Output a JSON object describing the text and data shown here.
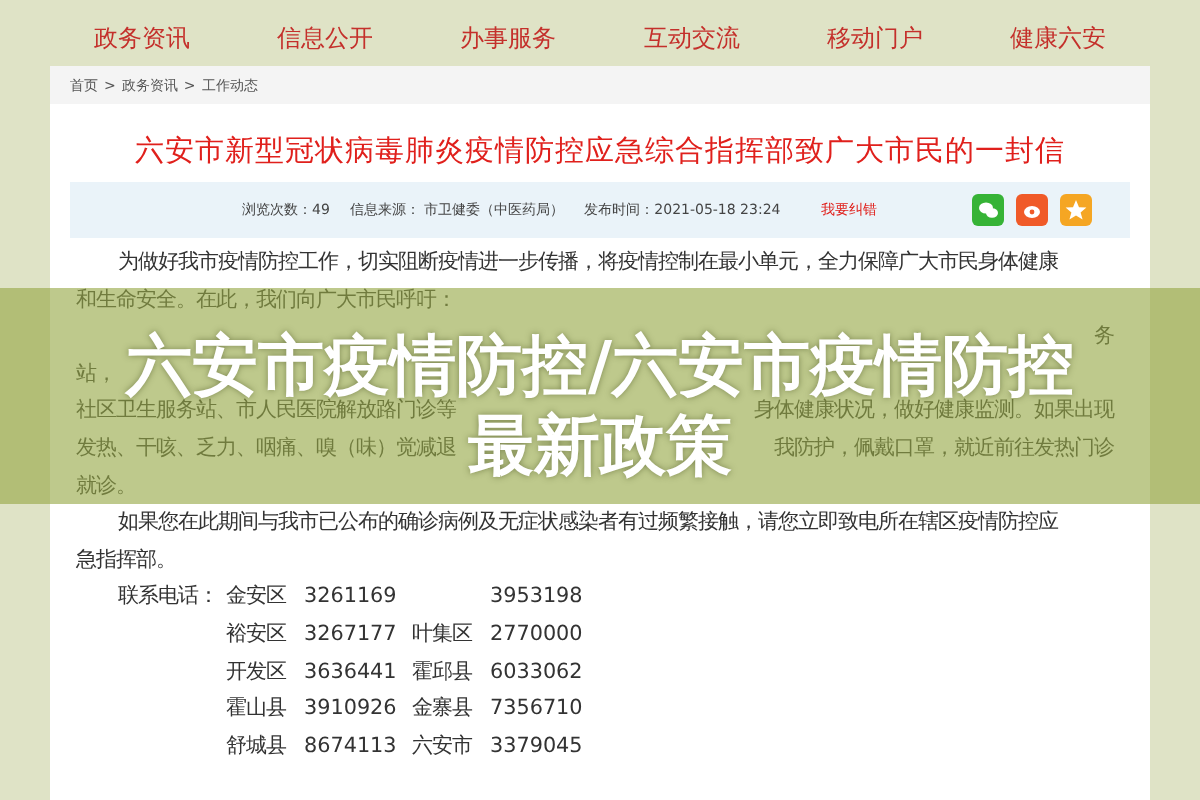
{
  "nav": [
    "政务资讯",
    "信息公开",
    "办事服务",
    "互动交流",
    "移动门户",
    "健康六安"
  ],
  "breadcrumb": {
    "items": [
      "首页",
      "政务资讯",
      "工作动态"
    ],
    "separator": ">"
  },
  "article": {
    "title": "六安市新型冠状病毒肺炎疫情防控应急综合指挥部致广大市民的一封信",
    "meta": [
      "浏览次数：49",
      "信息来源： 市卫健委（中医药局）",
      "发布时间：2021-05-18 23:24"
    ],
    "report_link": "我要纠错",
    "lines": [
      {
        "kind": "first",
        "text": "为做好我市疫情防控工作，切实阻断疫情进一步传播，将疫情控制在最小单元，全力保障广大市民身体健康"
      },
      {
        "kind": "cont",
        "text": "和生命安全。在此，我们向广大市民呼吁："
      },
      {
        "kind": "split",
        "right": "务"
      },
      {
        "kind": "split",
        "left": "站，"
      },
      {
        "kind": "split",
        "left": "社区卫生服务站、市人民医院解放路门诊等",
        "right": "身体健康状况，做好健康监测。如果出现"
      },
      {
        "kind": "split",
        "left": "发热、干咳、乏力、咽痛、嗅（味）觉减退",
        "right": "我防护，佩戴口罩，就近前往发热门诊"
      },
      {
        "kind": "cont",
        "text": "就诊。"
      },
      {
        "kind": "first",
        "text": "如果您在此期间与我市已公布的确诊病例及无症状感染者有过频繁接触，请您立即致电所在辖区疫情防控应"
      },
      {
        "kind": "cont",
        "text": "急指挥部。"
      }
    ],
    "contacts": {
      "label": "联系电话：",
      "rows": [
        {
          "district_1": "金安区",
          "phone_1": "3261169",
          "phone_2": "3953198"
        },
        {
          "district_1": "裕安区",
          "phone_1": "3267177",
          "district_2": "叶集区",
          "phone_2": "2770000"
        },
        {
          "district_1": "开发区",
          "phone_1": "3636441",
          "district_2": "霍邱县",
          "phone_2": "6033062"
        },
        {
          "district_1": "霍山县",
          "phone_1": "3910926",
          "district_2": "金寨县",
          "phone_2": "7356710"
        },
        {
          "district_1": "舒城县",
          "phone_1": "8674113",
          "district_2": "六安市",
          "phone_2": "3379045"
        }
      ]
    }
  },
  "banner": {
    "title_lines": [
      "六安市疫情防控/六安市疫情防控",
      "最新政策"
    ]
  }
}
